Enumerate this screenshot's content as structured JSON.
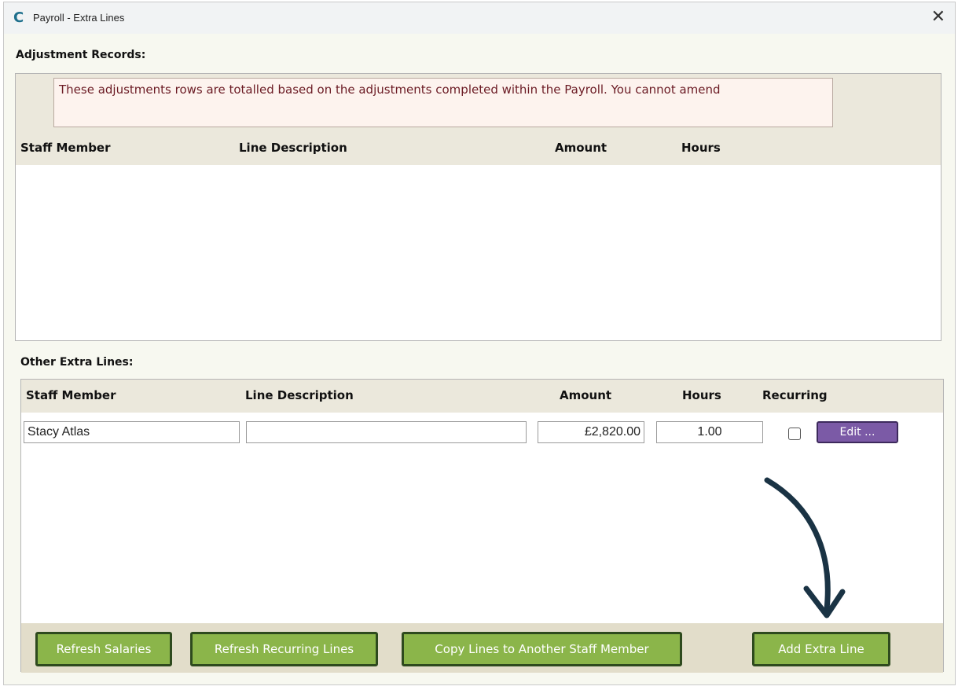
{
  "window": {
    "title": "Payroll - Extra Lines",
    "app_icon_glyph": "C",
    "close_glyph": "✕"
  },
  "adjustment_records": {
    "label": "Adjustment Records:",
    "notice": "These adjustments rows are totalled based on the adjustments completed within the Payroll.  You cannot amend",
    "columns": [
      "Staff Member",
      "Line Description",
      "Amount",
      "Hours"
    ]
  },
  "other_extra_lines": {
    "label": "Other Extra Lines:",
    "columns": [
      "Staff Member",
      "Line Description",
      "Amount",
      "Hours",
      "Recurring"
    ],
    "rows": [
      {
        "staff_member": "Stacy Atlas",
        "line_description": "",
        "amount": "£2,820.00",
        "hours": "1.00",
        "recurring": false,
        "edit_label": "Edit ..."
      }
    ]
  },
  "footer": {
    "refresh_salaries": "Refresh Salaries",
    "refresh_recurring": "Refresh Recurring Lines",
    "copy_lines": "Copy Lines to Another Staff Member",
    "add_extra_line": "Add Extra Line"
  },
  "colors": {
    "green_button": "#8bb54a",
    "purple_button": "#7b5aa6",
    "notice_text": "#6b1b24",
    "arrow": "#1a3344"
  }
}
